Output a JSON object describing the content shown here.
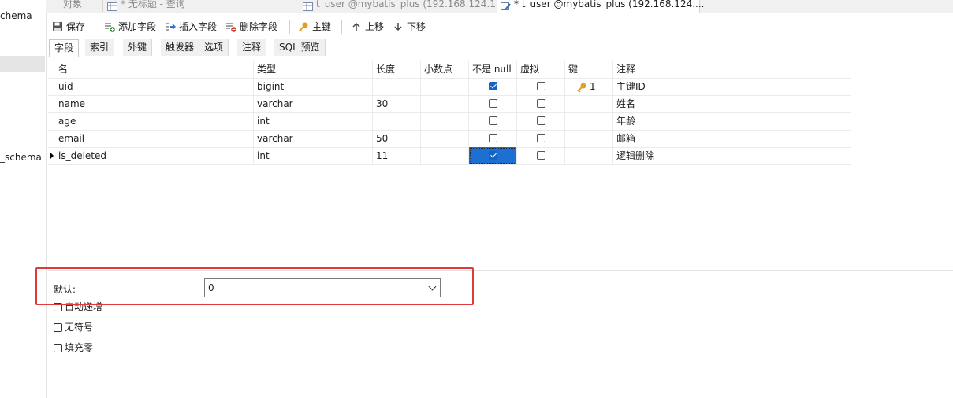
{
  "sidebar": {
    "items": [
      "chema",
      "_schema"
    ]
  },
  "tabs": [
    {
      "label": "对象",
      "active": false,
      "icon": "none"
    },
    {
      "label": "* 无标题 - 查询",
      "active": false,
      "icon": "query-icon"
    },
    {
      "label": "t_user @mybatis_plus (192.168.124.1...",
      "active": false,
      "icon": "table-icon"
    },
    {
      "label": "* t_user @mybatis_plus (192.168.124....",
      "active": true,
      "icon": "design-table-icon"
    }
  ],
  "toolbar": {
    "save": "保存",
    "add_field": "添加字段",
    "insert_field": "插入字段",
    "delete_field": "删除字段",
    "primary_key": "主键",
    "move_up": "上移",
    "move_down": "下移"
  },
  "subtabs": [
    "字段",
    "索引",
    "外键",
    "触发器",
    "选项",
    "注释",
    "SQL 预览"
  ],
  "columns": [
    "名",
    "类型",
    "长度",
    "小数点",
    "不是 null",
    "虚拟",
    "键",
    "注释"
  ],
  "rows": [
    {
      "name": "uid",
      "type": "bigint",
      "length": "",
      "decimals": "",
      "not_null": true,
      "virtual": false,
      "key": "1",
      "comment": "主键ID"
    },
    {
      "name": "name",
      "type": "varchar",
      "length": "30",
      "decimals": "",
      "not_null": false,
      "virtual": false,
      "key": "",
      "comment": "姓名"
    },
    {
      "name": "age",
      "type": "int",
      "length": "",
      "decimals": "",
      "not_null": false,
      "virtual": false,
      "key": "",
      "comment": "年龄"
    },
    {
      "name": "email",
      "type": "varchar",
      "length": "50",
      "decimals": "",
      "not_null": false,
      "virtual": false,
      "key": "",
      "comment": "邮箱"
    },
    {
      "name": "is_deleted",
      "type": "int",
      "length": "11",
      "decimals": "",
      "not_null": true,
      "virtual": false,
      "key": "",
      "comment": "逻辑删除"
    }
  ],
  "properties": {
    "default_label": "默认:",
    "default_value": "0",
    "auto_increment": "自动递增",
    "unsigned": "无符号",
    "zerofill": "填充零"
  },
  "colors": {
    "accent": "#1e6fd2",
    "highlight_box": "#e03a3a",
    "key_icon": "#e0a020"
  }
}
